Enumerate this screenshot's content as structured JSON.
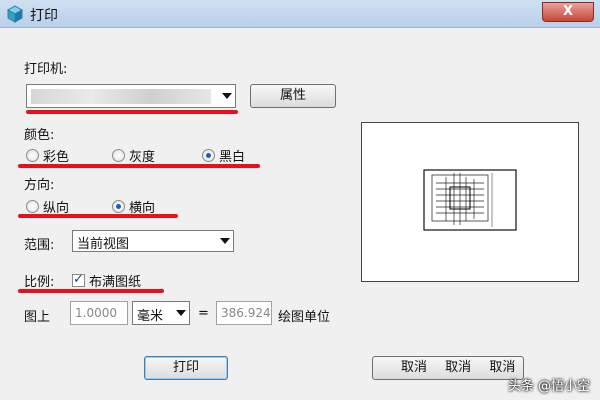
{
  "window": {
    "title": "打印",
    "close_label": "X"
  },
  "printer": {
    "label": "打印机:",
    "selected": "",
    "properties_button": "属性"
  },
  "color": {
    "label": "颜色:",
    "options": [
      "彩色",
      "灰度",
      "黑白"
    ],
    "selected": "黑白"
  },
  "orientation": {
    "label": "方向:",
    "options": [
      "纵向",
      "横向"
    ],
    "selected": "横向"
  },
  "range": {
    "label": "范围:",
    "selected": "当前视图"
  },
  "scale": {
    "label": "比例:",
    "fit_paper_label": "布满图纸",
    "fit_paper_checked": true
  },
  "units": {
    "label": "图上",
    "value": "1.0000",
    "unit": "毫米",
    "equals": "=",
    "drawing_value": "386.924",
    "drawing_unit_label": "绘图单位"
  },
  "actions": {
    "print": "打印",
    "cancel": "取消"
  },
  "watermark": "头条 @悟小空",
  "colors": {
    "annotation_red": "#e8101a",
    "radio_selected": "#1b5fb0"
  }
}
